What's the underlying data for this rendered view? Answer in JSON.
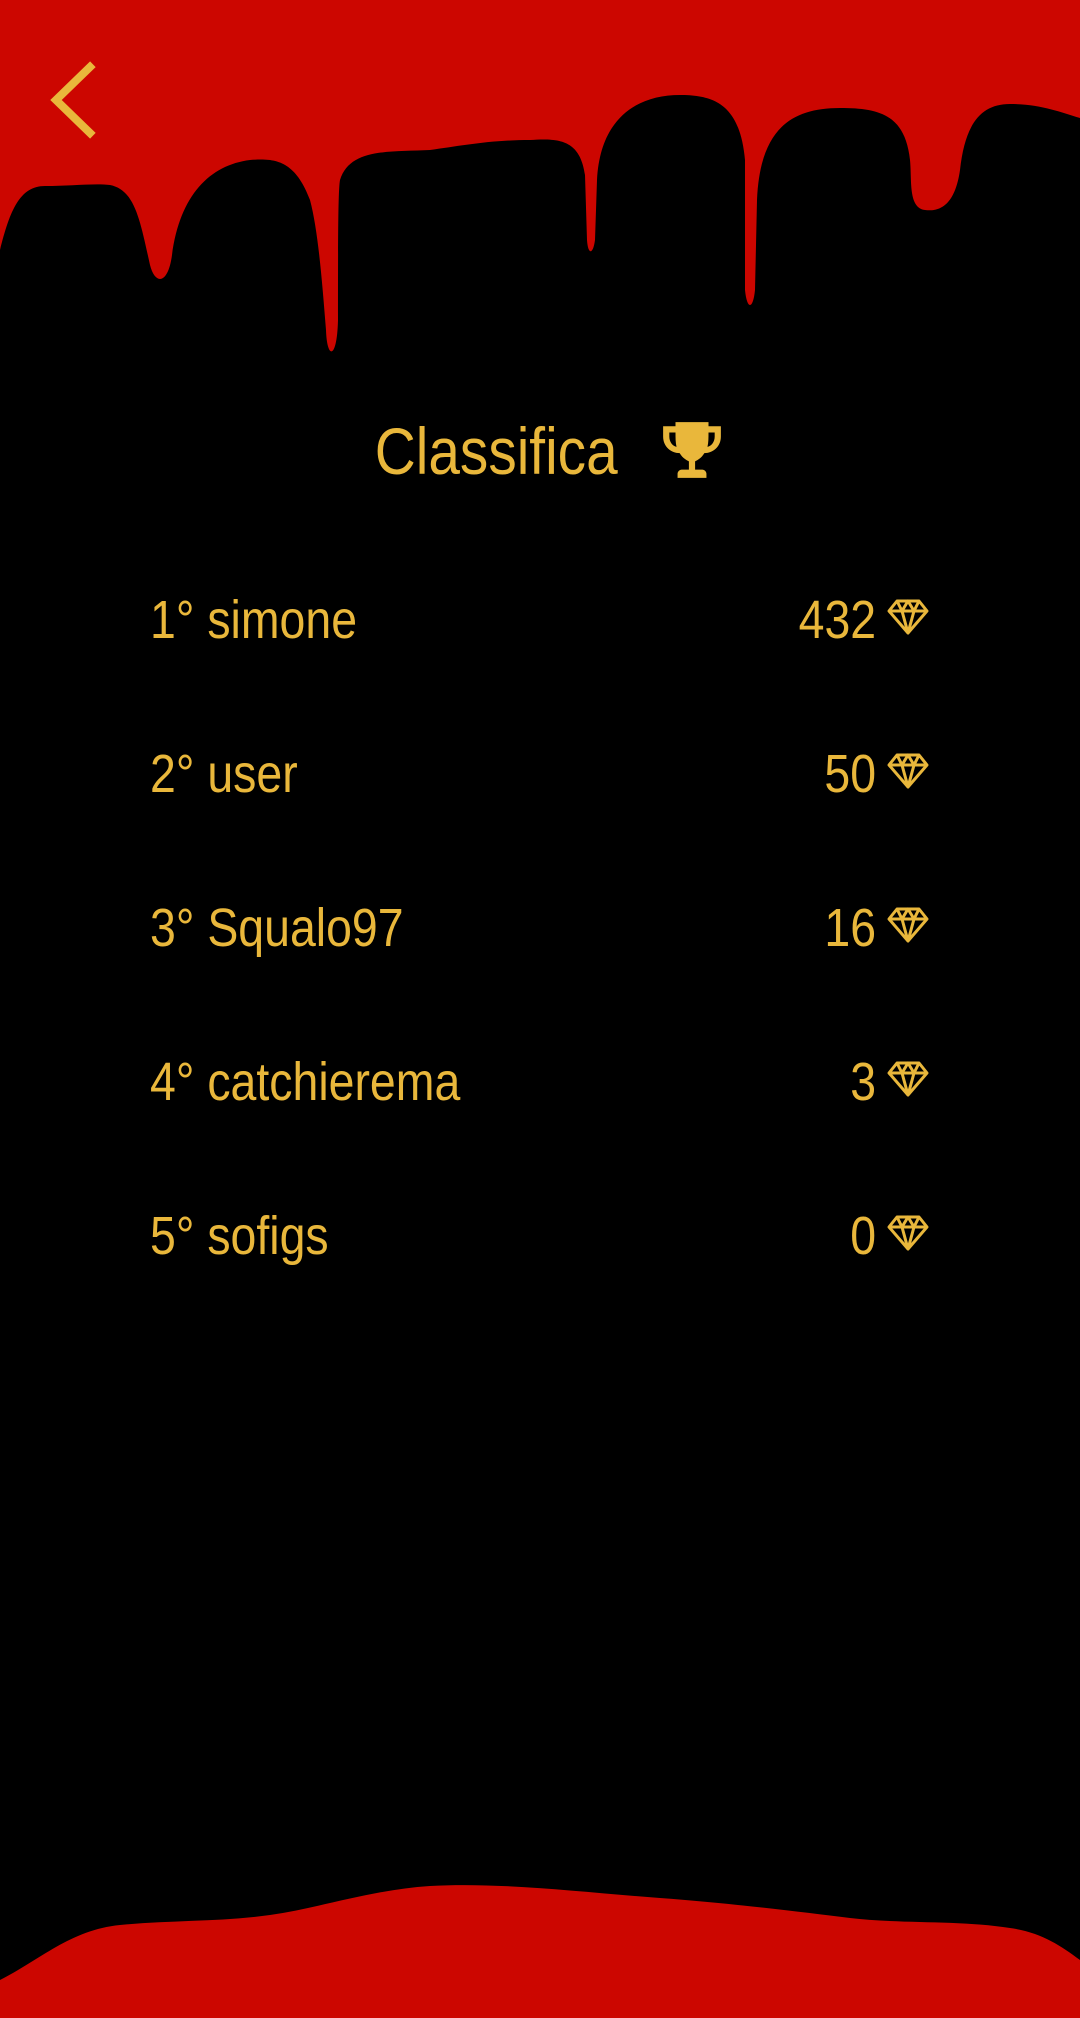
{
  "colors": {
    "background": "#000000",
    "drip_red": "#CC0600",
    "accent_gold": "#E9B73B"
  },
  "header": {
    "back_icon": "chevron-left-icon"
  },
  "title": {
    "text": "Classifica",
    "icon": "trophy-icon"
  },
  "leaderboard": [
    {
      "rank": "1°",
      "name": "simone",
      "score": "432",
      "icon": "diamond-icon"
    },
    {
      "rank": "2°",
      "name": "user",
      "score": "50",
      "icon": "diamond-icon"
    },
    {
      "rank": "3°",
      "name": "Squalo97",
      "score": "16",
      "icon": "diamond-icon"
    },
    {
      "rank": "4°",
      "name": "catchierema",
      "score": "3",
      "icon": "diamond-icon"
    },
    {
      "rank": "5°",
      "name": "sofigs",
      "score": "0",
      "icon": "diamond-icon"
    }
  ]
}
